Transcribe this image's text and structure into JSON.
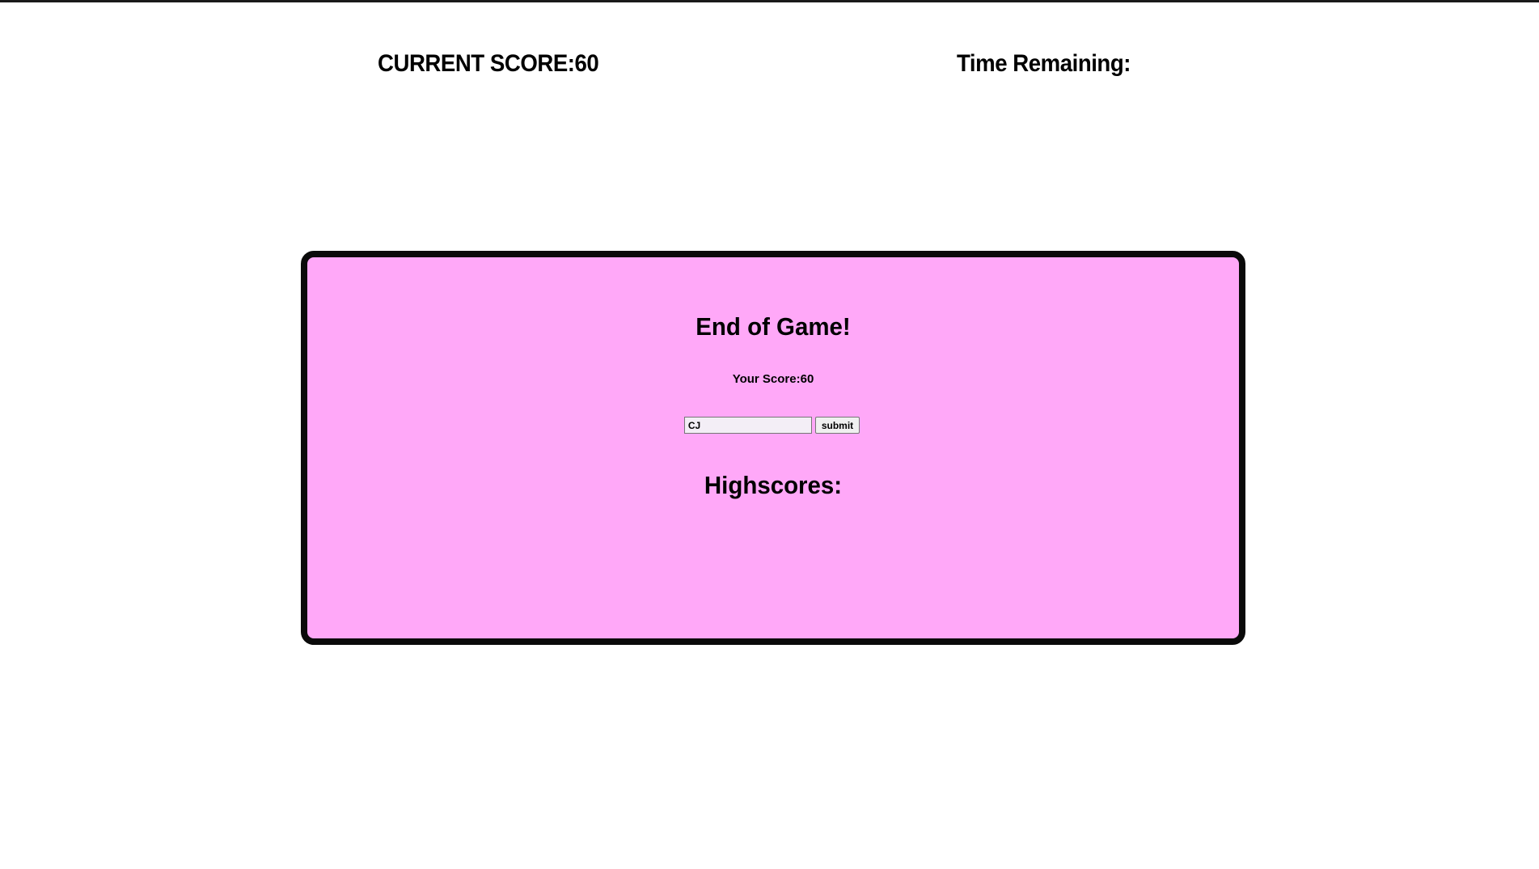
{
  "header": {
    "score_label": "CURRENT SCORE:",
    "score_value": "60",
    "time_label": "Time Remaining:",
    "time_value": ""
  },
  "panel": {
    "title": "End of Game!",
    "score_label": "Your Score:",
    "score_value": "60",
    "name_input_value": "CJ",
    "submit_label": "submit",
    "highscores_title": "Highscores:",
    "highscores": []
  },
  "colors": {
    "panel_background": "#ffa8f8",
    "panel_border": "#0a0a0a",
    "page_background": "#ffffff"
  }
}
